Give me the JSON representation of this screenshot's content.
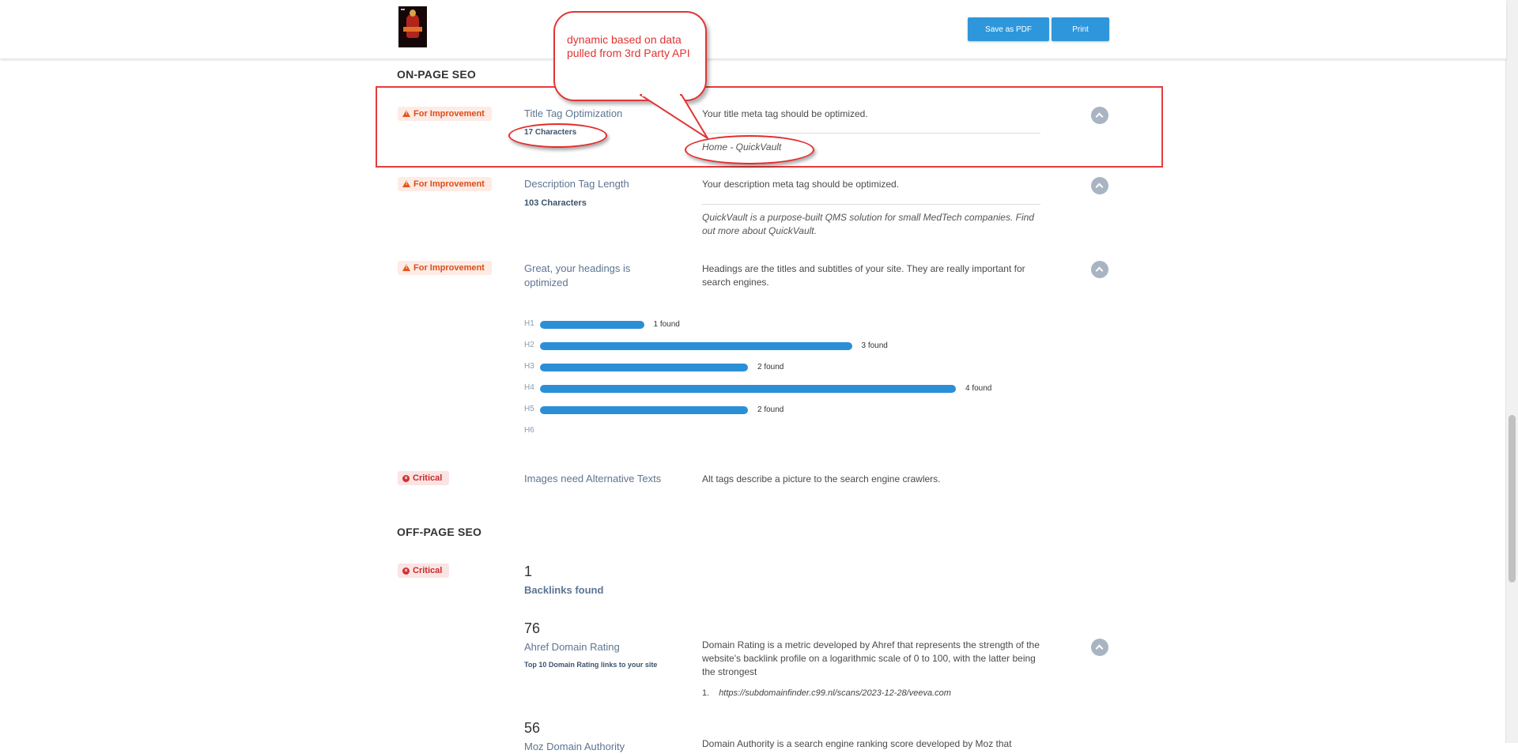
{
  "toolbar": {
    "save_pdf_label": "Save as PDF",
    "print_label": "Print"
  },
  "annotation": {
    "callout_text": "dynamic based on data pulled from 3rd Party API"
  },
  "onpage": {
    "section_title": "ON-PAGE SEO",
    "title_tag": {
      "badge": "For Improvement",
      "title": "Title Tag Optimization",
      "sub": "17 Characters",
      "desc": "Your title meta tag should be optimized.",
      "value": "Home - QuickVault"
    },
    "desc_tag": {
      "badge": "For Improvement",
      "title": "Description Tag Length",
      "sub": "103 Characters",
      "desc": "Your description meta tag should be optimized.",
      "value": "QuickVault is a purpose-built QMS solution for small MedTech companies. Find out more about QuickVault."
    },
    "headings": {
      "badge": "For Improvement",
      "title": "Great, your headings is optimized",
      "desc": "Headings are the titles and subtitles of your site. They are really important for search engines.",
      "rows": [
        {
          "tag": "H1",
          "count": 1,
          "label": "1 found"
        },
        {
          "tag": "H2",
          "count": 3,
          "label": "3 found"
        },
        {
          "tag": "H3",
          "count": 2,
          "label": "2 found"
        },
        {
          "tag": "H4",
          "count": 4,
          "label": "4 found"
        },
        {
          "tag": "H5",
          "count": 2,
          "label": "2 found"
        },
        {
          "tag": "H6",
          "count": 0,
          "label": ""
        }
      ]
    },
    "alt_text": {
      "badge": "Critical",
      "title": "Images need Alternative Texts",
      "desc": "Alt tags describe a picture to the search engine crawlers."
    }
  },
  "offpage": {
    "section_title": "OFF-PAGE SEO",
    "backlinks": {
      "badge": "Critical",
      "value": "1",
      "label": "Backlinks found"
    },
    "domain_rating": {
      "value": "76",
      "title": "Ahref Domain Rating",
      "sub": "Top 10 Domain Rating links to your site",
      "desc": "Domain Rating is a metric developed by Ahref that represents the strength of the website's backlink profile on a logarithmic scale of 0 to 100, with the latter being the strongest",
      "links": [
        {
          "num": "1.",
          "url": "https://subdomainfinder.c99.nl/scans/2023-12-28/veeva.com"
        }
      ]
    },
    "domain_authority": {
      "value": "56",
      "title": "Moz Domain Authority",
      "desc": "Domain Authority is a search engine ranking score developed by Moz that"
    }
  }
}
